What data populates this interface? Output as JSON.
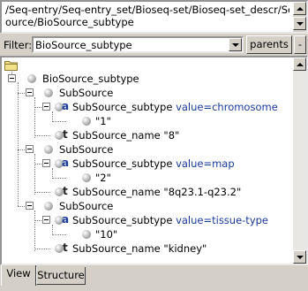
{
  "path": {
    "line1": "/Seq-entry/Seq-entry_set/Bioseq-set/Bioseq-set_descr/Seq-",
    "line2": "ource/BioSource_subtype"
  },
  "filter": {
    "label": "Filter:",
    "value": "BioSource_subtype",
    "parents_label": "parents",
    "minus_label": "-"
  },
  "tree": {
    "root": "BioSource_subtype",
    "subsources": [
      {
        "label": "SubSource",
        "subtype_label": "SubSource_subtype",
        "attr": "value=chromosome",
        "code": "\"1\"",
        "name_label": "SubSource_name",
        "name_value": "\"8\""
      },
      {
        "label": "SubSource",
        "subtype_label": "SubSource_subtype",
        "attr": "value=map",
        "code": "\"2\"",
        "name_label": "SubSource_name",
        "name_value": "\"8q23.1-q23.2\""
      },
      {
        "label": "SubSource",
        "subtype_label": "SubSource_subtype",
        "attr": "value=tissue-type",
        "code": "\"10\"",
        "name_label": "SubSource_name",
        "name_value": "\"kidney\""
      }
    ]
  },
  "tabs": [
    {
      "label": "View",
      "active": true
    },
    {
      "label": "Structure",
      "active": false
    }
  ]
}
